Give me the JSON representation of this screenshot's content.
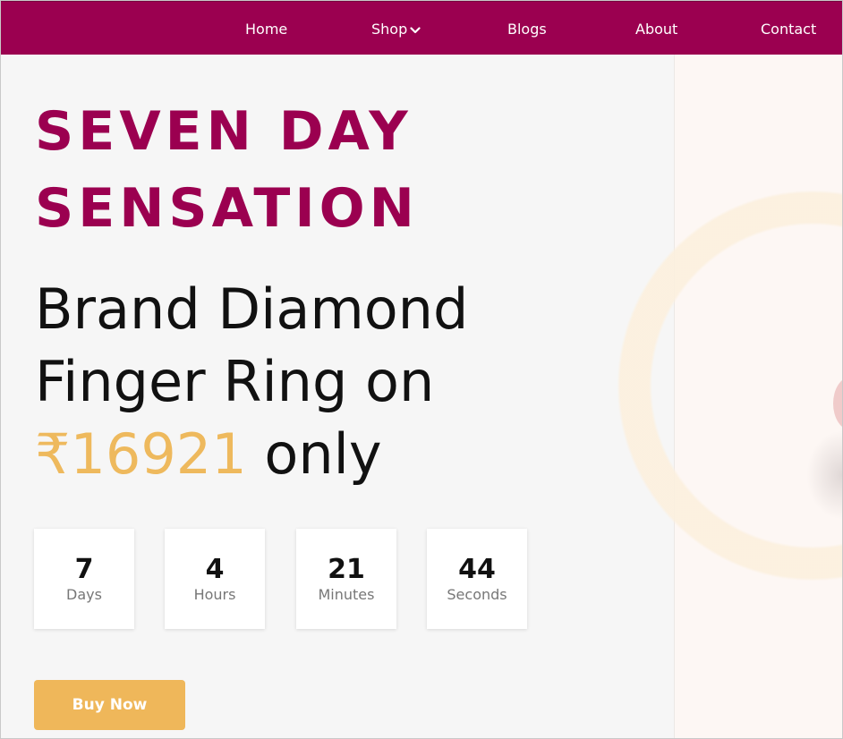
{
  "nav": {
    "items": [
      {
        "label": "Home"
      },
      {
        "label": "Shop",
        "icon": "chevron-down-icon"
      },
      {
        "label": "Blogs"
      },
      {
        "label": "About"
      },
      {
        "label": "Contact"
      }
    ]
  },
  "hero": {
    "title_line1": "SEVEN DAY",
    "title_line2": "SENSATION",
    "product_line1": "Brand Diamond",
    "product_line2": "Finger Ring on",
    "price": "₹16921",
    "price_suffix": " only"
  },
  "countdown": [
    {
      "value": "7",
      "label": "Days"
    },
    {
      "value": "4",
      "label": "Hours"
    },
    {
      "value": "21",
      "label": "Minutes"
    },
    {
      "value": "44",
      "label": "Seconds"
    }
  ],
  "cta": {
    "label": "Buy Now"
  },
  "colors": {
    "brand": "#9b0050",
    "accent": "#eeb95d",
    "button": "#efb75a",
    "background": "#f6f6f6"
  }
}
